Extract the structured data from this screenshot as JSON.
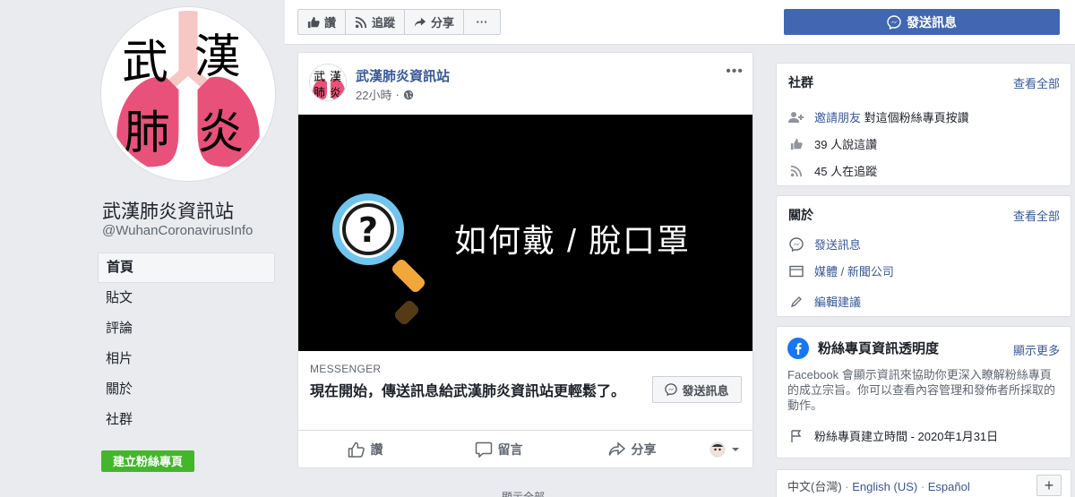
{
  "page": {
    "name": "武漢肺炎資訊站",
    "handle": "@WuhanCoronavirusInfo",
    "avatar_chars": [
      "武",
      "漢",
      "肺",
      "炎"
    ]
  },
  "nav": {
    "items": [
      {
        "label": "首頁",
        "active": true
      },
      {
        "label": "貼文",
        "active": false
      },
      {
        "label": "評論",
        "active": false
      },
      {
        "label": "相片",
        "active": false
      },
      {
        "label": "關於",
        "active": false
      },
      {
        "label": "社群",
        "active": false
      }
    ],
    "create_page_label": "建立粉絲專頁"
  },
  "actionbar": {
    "like_label": "讚",
    "follow_label": "追蹤",
    "share_label": "分享",
    "more_label": "···",
    "send_message_label": "發送訊息"
  },
  "post": {
    "author": "武漢肺炎資訊站",
    "time": "22小時",
    "time_sep": "·",
    "media_text": "如何戴 / 脫口罩",
    "cta_source": "MESSENGER",
    "cta_text": "現在開始，傳送訊息給武漢肺炎資訊站更輕鬆了。",
    "cta_button": "發送訊息",
    "actions": {
      "like": "讚",
      "comment": "留言",
      "share": "分享"
    }
  },
  "more_posts_label": "顯示全部",
  "community": {
    "title": "社群",
    "see_all": "查看全部",
    "invite_link": "邀請朋友",
    "invite_text": "對這個粉絲專頁按讚",
    "likes_text": "39 人說這讚",
    "follows_text": "45 人在追蹤"
  },
  "about": {
    "title": "關於",
    "see_all": "查看全部",
    "send_message": "發送訊息",
    "category": "媒體 / 新聞公司",
    "suggest_edit": "編輯建議"
  },
  "transparency": {
    "title": "粉絲專頁資訊透明度",
    "see_more": "顯示更多",
    "body": "Facebook 會顯示資訊來協助你更深入瞭解粉絲專頁的成立宗旨。你可以查看內容管理和發佈者所採取的動作。",
    "created": "粉絲專頁建立時間 - 2020年1月31日"
  },
  "languages": {
    "current": "中文(台灣)",
    "sep": " · ",
    "others": [
      "English (US)",
      "Español"
    ],
    "plus": "+"
  },
  "colors": {
    "fb_blue": "#4267b2",
    "link_blue": "#385898",
    "green": "#42b72a",
    "lung_pink": "#e8527a"
  }
}
